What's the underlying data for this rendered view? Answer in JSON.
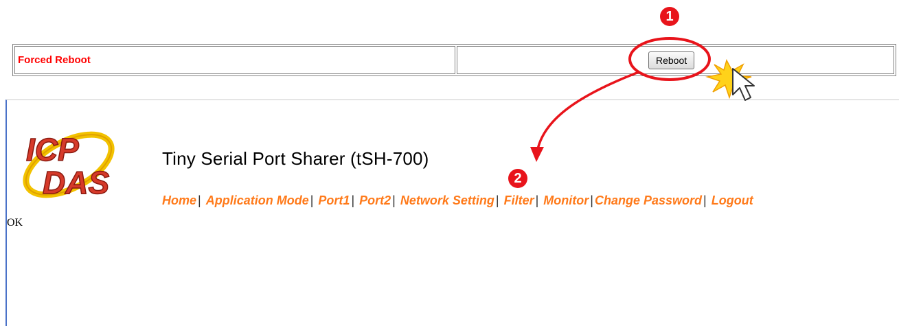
{
  "reboot_panel": {
    "label": "Forced Reboot",
    "button_label": "Reboot"
  },
  "annotations": {
    "step1": "1",
    "step2": "2"
  },
  "header": {
    "logo_text_top": "ICP",
    "logo_text_bottom": "DAS",
    "title": "Tiny Serial Port Sharer (tSH-700)"
  },
  "nav": {
    "items": [
      {
        "label": "Home"
      },
      {
        "label": "Application Mode"
      },
      {
        "label": "Port1"
      },
      {
        "label": "Port2"
      },
      {
        "label": "Network Setting"
      },
      {
        "label": "Filter"
      },
      {
        "label": "Monitor"
      },
      {
        "label": "Change Password"
      },
      {
        "label": "Logout"
      }
    ],
    "separator": "|"
  },
  "status": {
    "text": "OK"
  },
  "colors": {
    "label_red": "#ff0000",
    "nav_orange": "#ff7a1a",
    "annotation_red": "#e8141b",
    "frame_blue": "#4a72c8"
  }
}
